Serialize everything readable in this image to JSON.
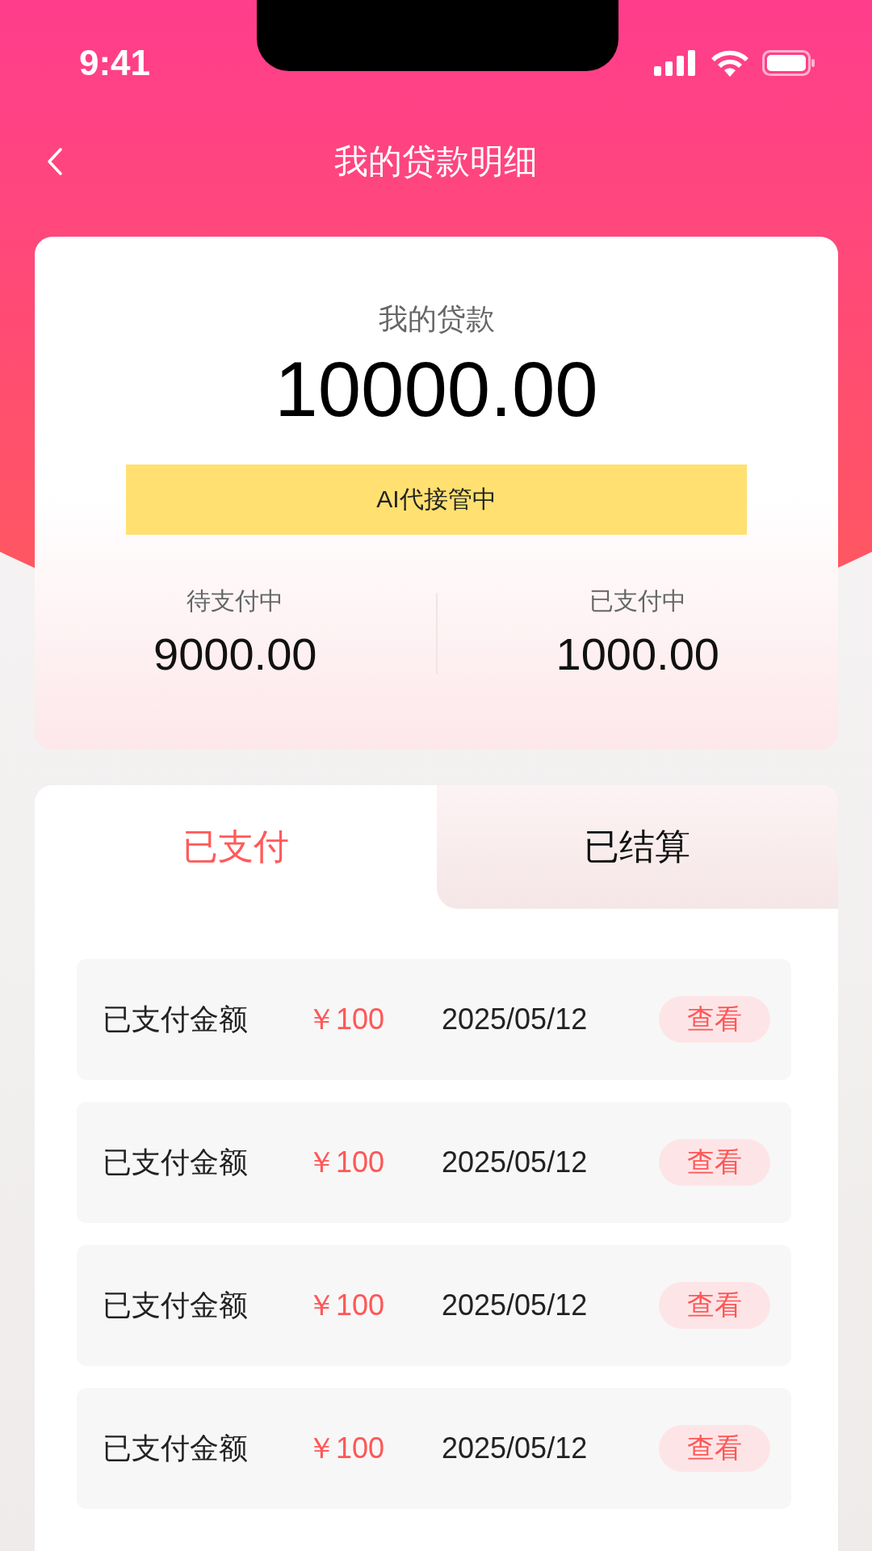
{
  "status_bar": {
    "time": "9:41"
  },
  "header": {
    "title": "我的贷款明细"
  },
  "summary": {
    "label": "我的贷款",
    "amount": "10000.00",
    "banner": "AI代接管中",
    "stats": [
      {
        "label": "待支付中",
        "value": "9000.00"
      },
      {
        "label": "已支付中",
        "value": "1000.00"
      }
    ]
  },
  "tabs": [
    {
      "label": "已支付",
      "selected": true
    },
    {
      "label": "已结算",
      "selected": false
    }
  ],
  "records": [
    {
      "label": "已支付金额",
      "amount": "￥100",
      "date": "2025/05/12",
      "action": "查看"
    },
    {
      "label": "已支付金额",
      "amount": "￥100",
      "date": "2025/05/12",
      "action": "查看"
    },
    {
      "label": "已支付金额",
      "amount": "￥100",
      "date": "2025/05/12",
      "action": "查看"
    },
    {
      "label": "已支付金额",
      "amount": "￥100",
      "date": "2025/05/12",
      "action": "查看"
    }
  ]
}
